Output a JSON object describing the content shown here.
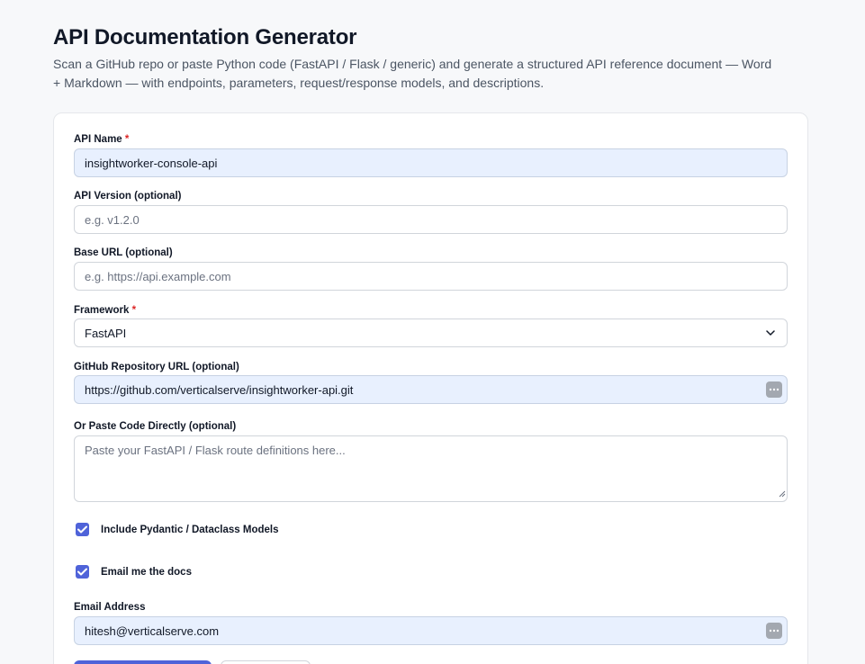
{
  "page": {
    "title": "API Documentation Generator",
    "description": "Scan a GitHub repo or paste Python code (FastAPI / Flask / generic) and generate a structured API reference document — Word + Markdown — with endpoints, parameters, request/response models, and descriptions."
  },
  "form": {
    "api_name": {
      "label": "API Name",
      "required_mark": "*",
      "value": "insightworker-console-api"
    },
    "api_version": {
      "label": "API Version (optional)",
      "placeholder": "e.g. v1.2.0"
    },
    "base_url": {
      "label": "Base URL (optional)",
      "placeholder": "e.g. https://api.example.com"
    },
    "framework": {
      "label": "Framework",
      "required_mark": "*",
      "selected": "FastAPI"
    },
    "github_url": {
      "label": "GitHub Repository URL (optional)",
      "value": "https://github.com/verticalserve/insightworker-api.git"
    },
    "paste_code": {
      "label": "Or Paste Code Directly (optional)",
      "placeholder": "Paste your FastAPI / Flask route definitions here..."
    },
    "include_models": {
      "label": "Include Pydantic / Dataclass Models",
      "checked": true
    },
    "email_me": {
      "label": "Email me the docs",
      "checked": true
    },
    "email_address": {
      "label": "Email Address",
      "value": "hitesh@verticalserve.com"
    }
  },
  "colors": {
    "accent": "#4f63d9",
    "autofill_bg": "#e8f0fe",
    "required": "#dc2626"
  },
  "icons": {
    "select": "chevron-down-icon",
    "password_manager": "more-dots-icon",
    "checkbox": "checkmark-icon"
  }
}
